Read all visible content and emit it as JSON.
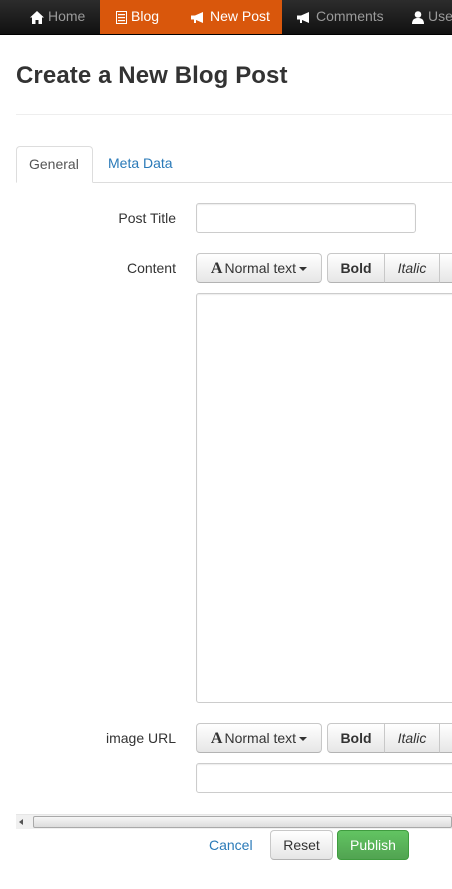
{
  "navbar": {
    "items": [
      {
        "label": "Home",
        "icon": "home-icon",
        "active": false
      },
      {
        "label": "Blog",
        "icon": "list-icon",
        "active": true
      },
      {
        "label": "New Post",
        "icon": "bullhorn-icon",
        "active": true
      },
      {
        "label": "Comments",
        "icon": "bullhorn-icon",
        "active": false
      },
      {
        "label": "Use",
        "icon": "user-icon",
        "active": false
      }
    ],
    "active_color": "#d9570c"
  },
  "page": {
    "title": "Create a New Blog Post"
  },
  "tabs": [
    {
      "label": "General",
      "active": true
    },
    {
      "label": "Meta Data",
      "active": false
    }
  ],
  "form": {
    "post_title_label": "Post Title",
    "post_title_value": "",
    "content_label": "Content",
    "content_value": "",
    "image_url_label": "image URL",
    "image_url_value": "",
    "toolbar": {
      "font_style": "Normal text",
      "bold": "Bold",
      "italic": "Italic"
    }
  },
  "actions": {
    "cancel": "Cancel",
    "reset": "Reset",
    "publish": "Publish"
  },
  "colors": {
    "link": "#2a7ab8",
    "publish": "#51a351"
  }
}
